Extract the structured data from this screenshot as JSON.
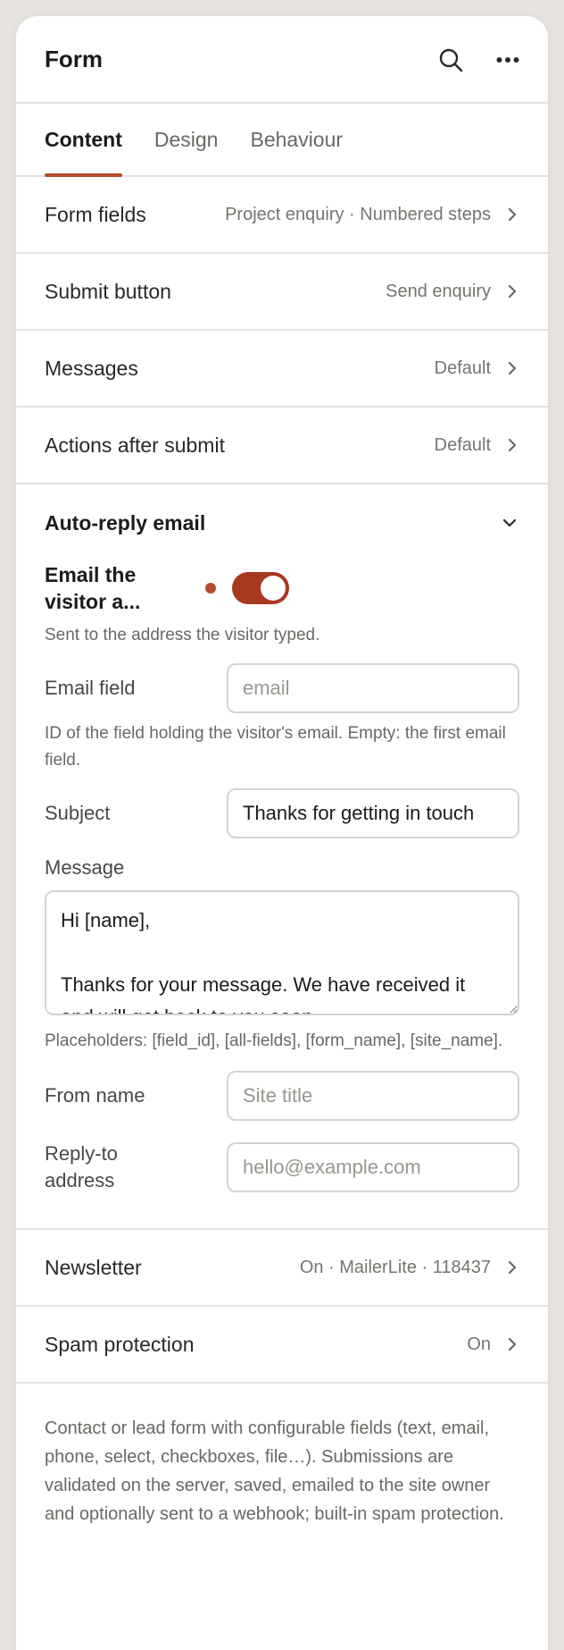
{
  "header": {
    "title": "Form",
    "search_icon": "search-icon",
    "more_icon": "more-horizontal-icon"
  },
  "tabs": [
    {
      "label": "Content",
      "active": true
    },
    {
      "label": "Design",
      "active": false
    },
    {
      "label": "Behaviour",
      "active": false
    }
  ],
  "rows_top": [
    {
      "label": "Form fields",
      "value": "Project enquiry · Numbered steps"
    },
    {
      "label": "Submit button",
      "value": "Send enquiry"
    },
    {
      "label": "Messages",
      "value": "Default"
    },
    {
      "label": "Actions after submit",
      "value": "Default"
    }
  ],
  "autoreply": {
    "title": "Auto-reply email",
    "toggle_label": "Email the visitor a...",
    "toggle_on": true,
    "toggle_help": "Sent to the address the visitor typed.",
    "email_field": {
      "label": "Email field",
      "placeholder": "email",
      "value": ""
    },
    "email_help": "ID of the field holding the visitor's email. Empty: the first email field.",
    "subject": {
      "label": "Subject",
      "value": "Thanks for getting in touch"
    },
    "message": {
      "label": "Message",
      "value": "Hi [name],\n\nThanks for your message. We have received it and will get back to you soon."
    },
    "placeholders_help": "Placeholders: [field_id], [all-fields], [form_name], [site_name].",
    "from_name": {
      "label": "From name",
      "placeholder": "Site title",
      "value": ""
    },
    "reply_to": {
      "label": "Reply-to address",
      "placeholder": "hello@example.com",
      "value": ""
    }
  },
  "rows_bottom": [
    {
      "label": "Newsletter",
      "value": "On · MailerLite · 118437"
    },
    {
      "label": "Spam protection",
      "value": "On"
    }
  ],
  "description": "Contact or lead form with configurable fields (text, email, phone, select, checkboxes, file…). Submissions are validated on the server, saved, emailed to the site owner and optionally sent to a webhook; built-in spam protection.",
  "colors": {
    "accent": "#b64a2e",
    "toggle": "#a8381f",
    "border": "#e3e1de",
    "background": "#e6e3e0"
  }
}
